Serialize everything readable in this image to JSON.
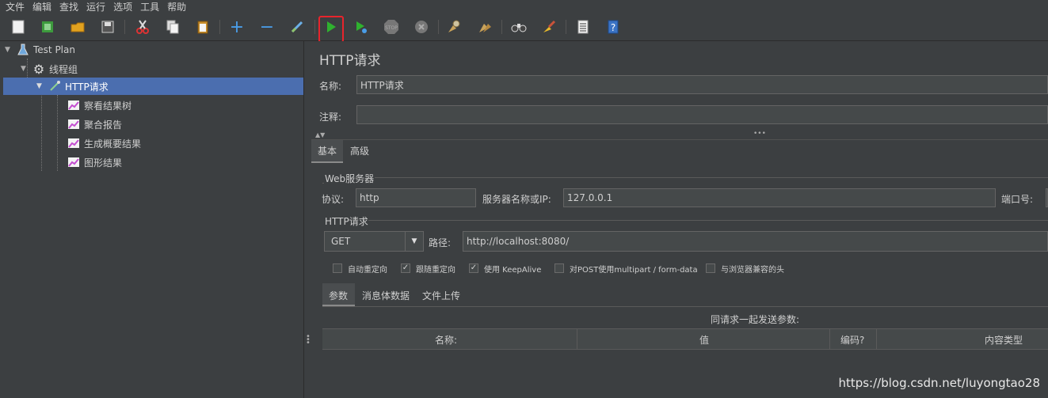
{
  "menu": [
    "文件",
    "编辑",
    "查找",
    "运行",
    "选项",
    "工具",
    "帮助"
  ],
  "toolbar": {
    "icons": [
      "new-icon",
      "templates-icon",
      "open-icon",
      "save-icon",
      "cut-icon",
      "copy-icon",
      "paste-icon",
      "expand-icon",
      "collapse-icon",
      "toggle-icon",
      "start-icon",
      "start-no-pause-icon",
      "stop-icon",
      "shutdown-icon",
      "clear-icon",
      "clear-all-icon",
      "search-icon",
      "reset-search-icon",
      "function-helper-icon",
      "help-icon"
    ]
  },
  "tree": {
    "test_plan": "Test Plan",
    "thread_group": "线程组",
    "http_request": "HTTP请求",
    "children": [
      "察看结果树",
      "聚合报告",
      "生成概要结果",
      "图形结果"
    ]
  },
  "panel": {
    "title": "HTTP请求",
    "name_label": "名称:",
    "name_value": "HTTP请求",
    "comment_label": "注释:",
    "comment_value": "",
    "tabs": [
      "基本",
      "高级"
    ],
    "web_server_group": "Web服务器",
    "protocol_label": "协议:",
    "protocol_value": "http",
    "server_label": "服务器名称或IP:",
    "server_value": "127.0.0.1",
    "port_label": "端口号:",
    "http_group": "HTTP请求",
    "method_value": "GET",
    "path_label": "路径:",
    "path_value": "http://localhost:8080/",
    "checkboxes": [
      {
        "label": "自动重定向",
        "checked": false
      },
      {
        "label": "跟随重定向",
        "checked": true
      },
      {
        "label": "使用 KeepAlive",
        "checked": true
      },
      {
        "label": "对POST使用multipart / form-data",
        "checked": false
      },
      {
        "label": "与浏览器兼容的头",
        "checked": false
      }
    ],
    "subtabs": [
      "参数",
      "消息体数据",
      "文件上传"
    ],
    "params_caption": "同请求一起发送参数:",
    "columns": [
      "名称:",
      "值",
      "编码?",
      "内容类型"
    ]
  },
  "watermark": "https://blog.csdn.net/luyongtao28"
}
